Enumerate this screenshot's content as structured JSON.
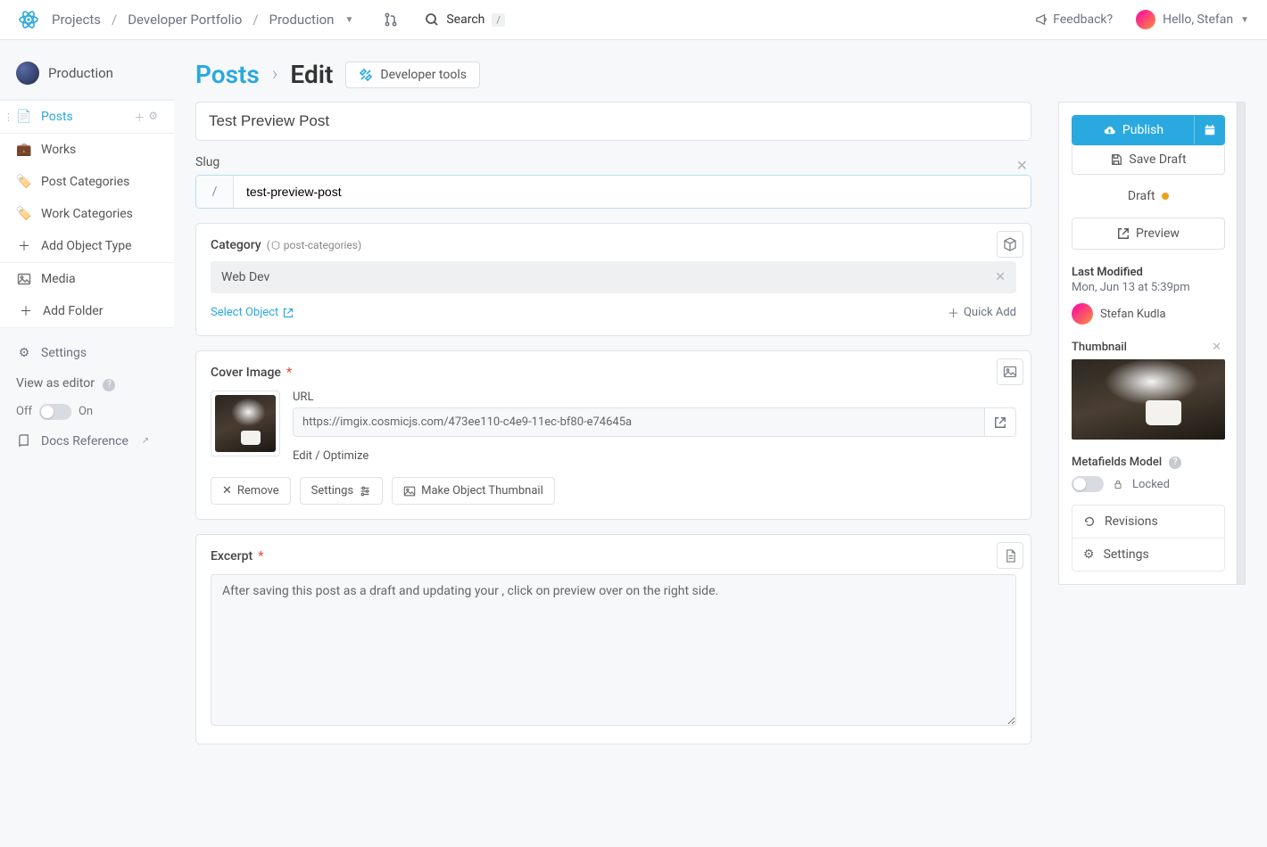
{
  "topbar": {
    "breadcrumbs": [
      "Projects",
      "Developer Portfolio",
      "Production"
    ],
    "search_label": "Search",
    "feedback": "Feedback?",
    "greeting": "Hello, Stefan"
  },
  "sidebar": {
    "bucket": "Production",
    "items": [
      {
        "label": "Posts",
        "icon": "📄",
        "active": true
      },
      {
        "label": "Works",
        "icon": "💼"
      },
      {
        "label": "Post Categories",
        "icon": "🏷️"
      },
      {
        "label": "Work Categories",
        "icon": "🏷️"
      }
    ],
    "add_object_type": "Add Object Type",
    "media": "Media",
    "add_folder": "Add Folder",
    "settings": "Settings",
    "view_as_editor": "View as editor",
    "off": "Off",
    "on": "On",
    "docs_reference": "Docs Reference"
  },
  "page": {
    "section": "Posts",
    "title": "Edit",
    "dev_tools": "Developer tools"
  },
  "form": {
    "post_title": "Test Preview Post",
    "slug_label": "Slug",
    "slug_prefix": "/",
    "slug_value": "test-preview-post",
    "category": {
      "label": "Category",
      "type_label": "post-categories",
      "chip": "Web Dev",
      "select_object": "Select Object",
      "quick_add": "Quick Add"
    },
    "cover": {
      "label": "Cover Image",
      "url_label": "URL",
      "url": "https://imgix.cosmicjs.com/473ee110-c4e9-11ec-bf80-e74645a",
      "edit_label": "Edit / Optimize",
      "remove": "Remove",
      "settings": "Settings",
      "make_thumb": "Make Object Thumbnail"
    },
    "excerpt": {
      "label": "Excerpt",
      "value": "After saving this post as a draft and updating your , click on preview over on the right side."
    }
  },
  "rail": {
    "publish": "Publish",
    "save_draft": "Save Draft",
    "status": "Draft",
    "preview": "Preview",
    "last_modified_label": "Last Modified",
    "last_modified": "Mon, Jun 13 at 5:39pm",
    "author": "Stefan Kudla",
    "thumbnail_label": "Thumbnail",
    "metafields_label": "Metafields Model",
    "locked": "Locked",
    "revisions": "Revisions",
    "settings": "Settings"
  }
}
